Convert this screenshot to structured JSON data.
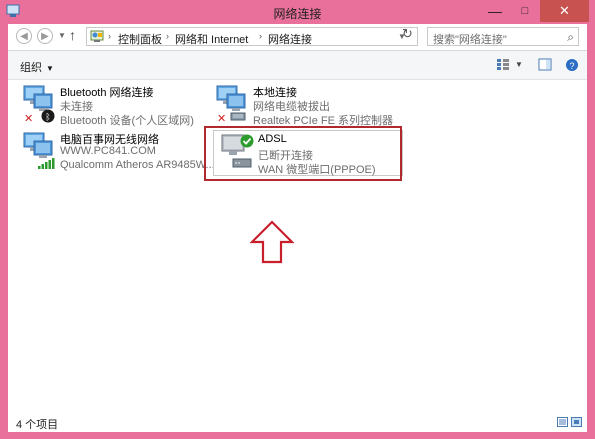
{
  "window": {
    "title": "网络连接"
  },
  "address": {
    "breadcrumbs": [
      "控制面板",
      "网络和 Internet",
      "网络连接"
    ],
    "search_placeholder": "搜索\"网络连接\""
  },
  "toolbar": {
    "organize_label": "组织"
  },
  "connections": [
    {
      "name": "Bluetooth 网络连接",
      "status": "未连接",
      "device": "Bluetooth 设备(个人区域网)",
      "icon": "bluetooth-network-icon",
      "badge": "disconnected-x-icon"
    },
    {
      "name": "本地连接",
      "status": "网络电缆被拔出",
      "device": "Realtek PCIe FE 系列控制器",
      "icon": "ethernet-network-icon",
      "badge": "disconnected-x-icon"
    },
    {
      "name": "电脑百事网无线网络",
      "status": "WWW.PC841.COM",
      "device": "Qualcomm Atheros AR9485W...",
      "icon": "wireless-network-icon",
      "badge": "signal-bars-icon"
    },
    {
      "name": "ADSL",
      "status": "已断开连接",
      "device": "WAN 微型端口(PPPOE)",
      "icon": "broadband-network-icon",
      "badge": "check-icon"
    }
  ],
  "statusbar": {
    "item_count": "4 个项目"
  },
  "colors": {
    "window_frame": "#e8709a",
    "highlight_box": "#b0292e",
    "close_button": "#c7524f"
  }
}
